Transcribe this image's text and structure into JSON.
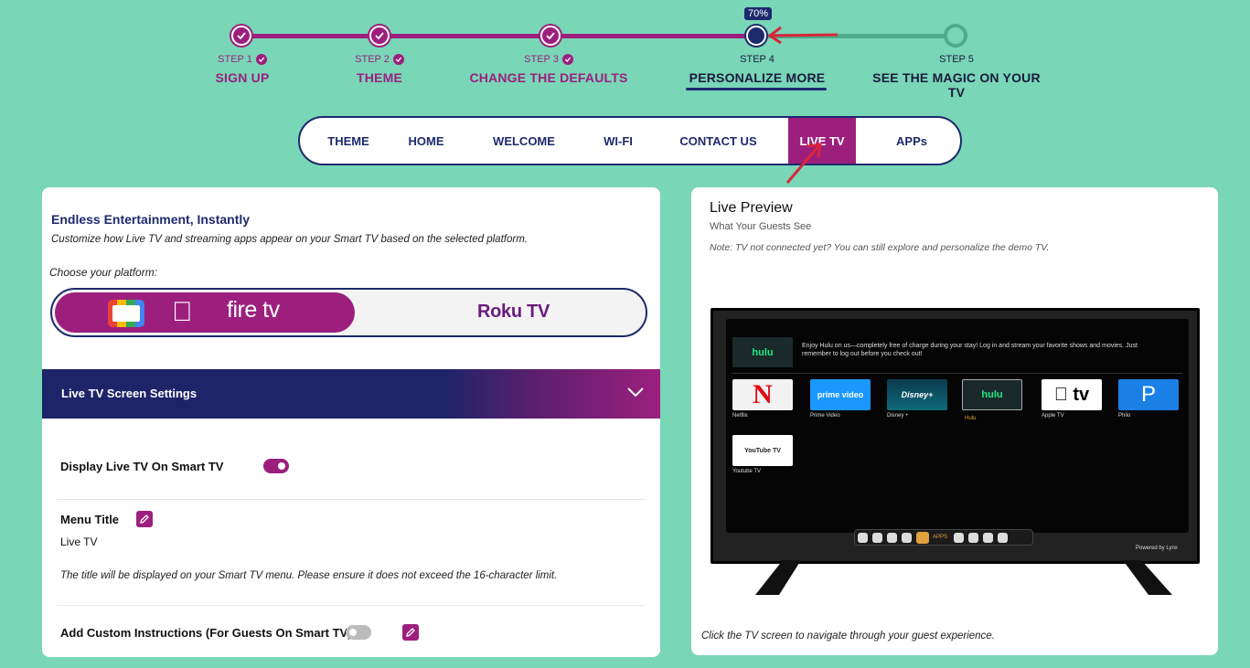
{
  "progress": {
    "badge": "70%",
    "steps": [
      {
        "num": "STEP 1",
        "title": "SIGN UP"
      },
      {
        "num": "STEP 2",
        "title": "THEME"
      },
      {
        "num": "STEP 3",
        "title": "CHANGE THE DEFAULTS"
      },
      {
        "num": "STEP 4",
        "title": "PERSONALIZE MORE"
      },
      {
        "num": "STEP 5",
        "title": "SEE THE MAGIC ON YOUR TV"
      }
    ],
    "fraction": 0.7
  },
  "nav": [
    "THEME",
    "HOME",
    "WELCOME",
    "WI-FI",
    "CONTACT US",
    "LIVE TV",
    "APPs"
  ],
  "left": {
    "heading": "Endless Entertainment, Instantly",
    "subtitle": "Customize how Live TV and streaming apps appear on your Smart TV based on the selected platform.",
    "choose": "Choose your platform:",
    "firetv": "fire tv",
    "roku": "Roku TV",
    "accordion_title": "Live TV Screen Settings",
    "display_label": "Display Live TV On Smart TV",
    "display_on": true,
    "menu_title_label": "Menu Title",
    "menu_title_value": "Live TV",
    "menu_note": "The title will be displayed on your Smart TV menu. Please ensure it does not exceed the 16-character limit.",
    "custom_label": "Add Custom Instructions (For Guests On Smart TV)",
    "custom_on": false
  },
  "right": {
    "title": "Live Preview",
    "sub": "What Your Guests See",
    "note": "Note: TV not connected yet? You can still explore and personalize the demo TV.",
    "footer": "Click the TV screen to navigate through your guest experience.",
    "tv": {
      "banner_logo": "hulu",
      "banner_text": "Enjoy Hulu on us—completely free of charge during your stay! Log in and stream your favorite shows and movies. Just remember to log out before you check out!",
      "apps": [
        {
          "logo": "N",
          "name": "Netflix"
        },
        {
          "logo": "prime video",
          "name": "Prime Video"
        },
        {
          "logo": "Disney+",
          "name": "Disney +"
        },
        {
          "logo": "hulu",
          "name": "Hulu"
        },
        {
          "logo": " tv",
          "name": "Apple TV"
        },
        {
          "logo": "P",
          "name": "Philo"
        },
        {
          "logo": "YouTube TV",
          "name": "Youtube TV"
        }
      ],
      "dock_apps_label": "APPS",
      "powered": "Powered by Lynx"
    }
  },
  "colors": {
    "accent": "#9c1f7e",
    "navy": "#1d2a6e",
    "bg": "#79d6b6"
  }
}
